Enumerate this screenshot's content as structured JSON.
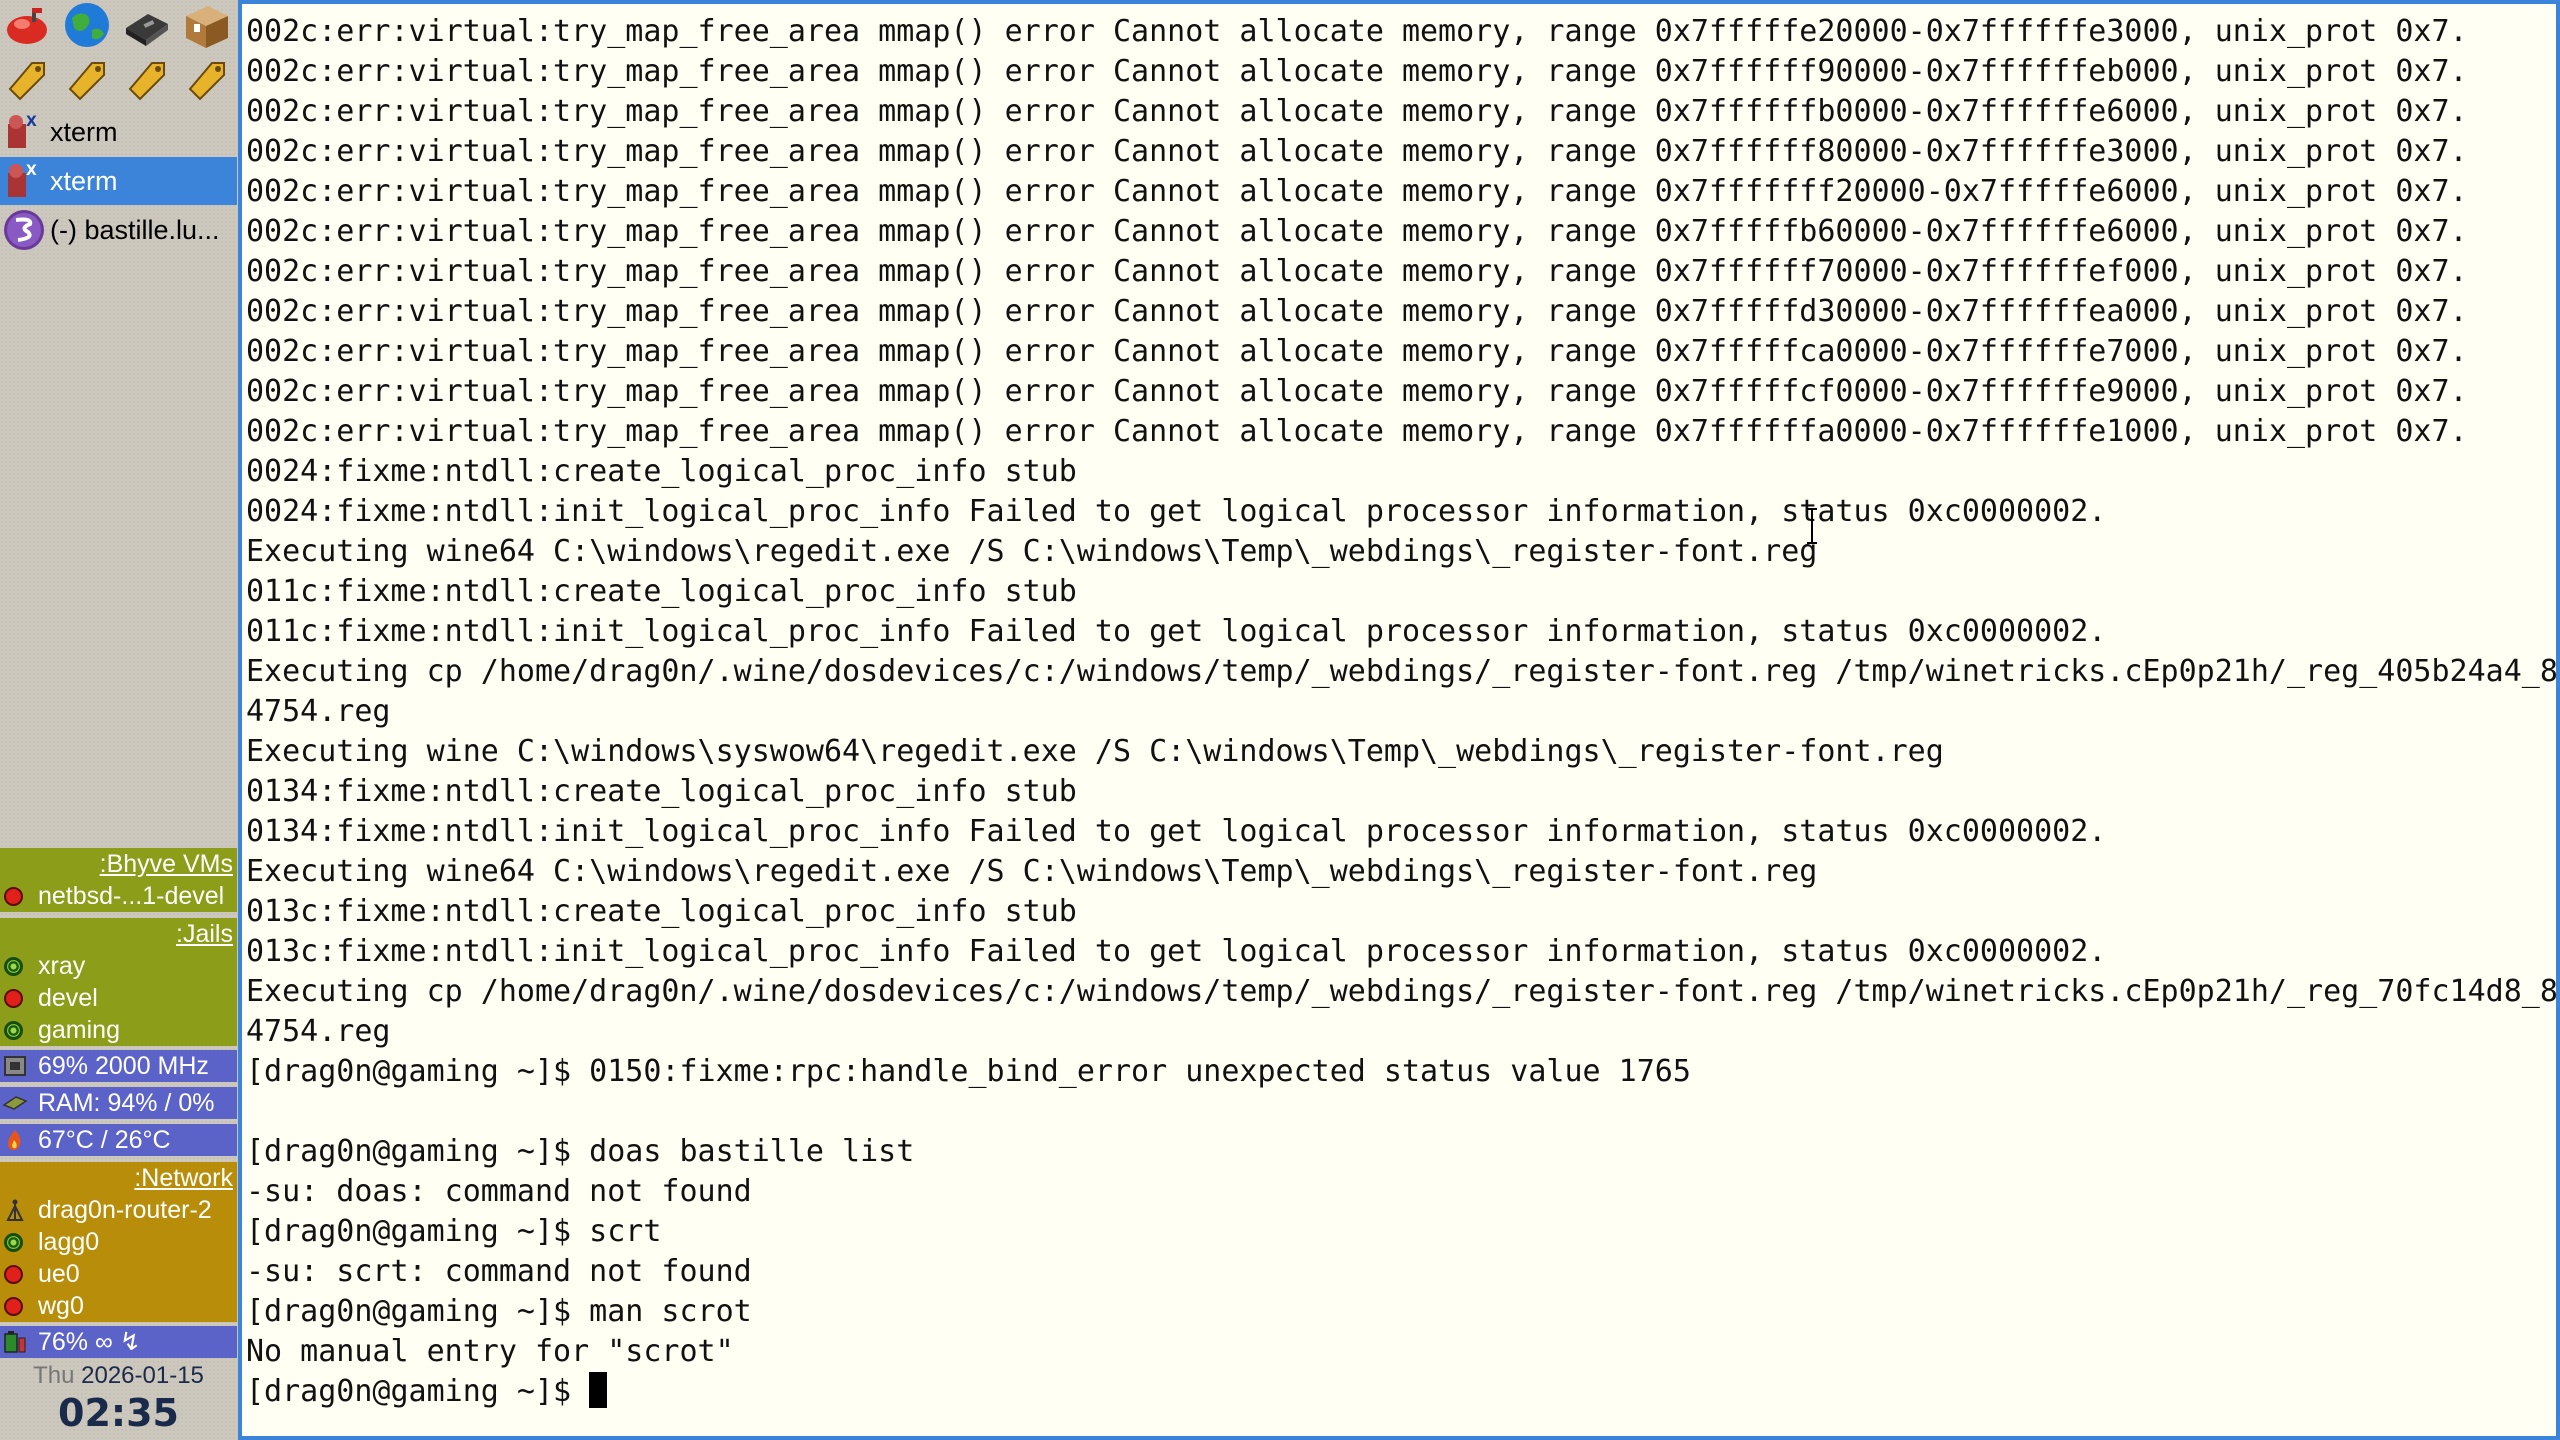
{
  "launchers": {
    "row1": [
      "mail-icon",
      "globe-icon",
      "disk-drive-icon",
      "package-icon"
    ],
    "row2": [
      "tag-icon",
      "tag-icon",
      "tag-icon",
      "tag-icon"
    ]
  },
  "tasks": [
    {
      "label": "xterm",
      "icon": "xterm-icon",
      "active": false
    },
    {
      "label": "xterm",
      "icon": "xterm-icon",
      "active": true
    },
    {
      "label": "(-) bastille.lu...",
      "icon": "emacs-icon",
      "active": false
    }
  ],
  "bhyve": {
    "header": ":Bhyve VMs",
    "items": [
      {
        "label": "netbsd-...1-devel",
        "status": "stopped"
      }
    ]
  },
  "jails": {
    "header": ":Jails",
    "items": [
      {
        "label": "xray",
        "status": "running"
      },
      {
        "label": "devel",
        "status": "stopped"
      },
      {
        "label": "gaming",
        "status": "running"
      }
    ]
  },
  "system": {
    "cpu": "69% 2000 MHz",
    "ram": "RAM: 94% / 0%",
    "temp": "67°C / 26°C"
  },
  "network": {
    "header": ":Network",
    "router": "drag0n-router-2",
    "items": [
      {
        "label": "lagg0",
        "status": "up"
      },
      {
        "label": "ue0",
        "status": "down"
      },
      {
        "label": "wg0",
        "status": "down"
      }
    ]
  },
  "battery": "76% ∞ ↯",
  "clock": {
    "day": "Thu",
    "date": "2026-01-15",
    "time": "02:35"
  },
  "terminal": {
    "lines": [
      "002c:err:virtual:try_map_free_area mmap() error Cannot allocate memory, range 0x7fffffe20000-0x7ffffffe3000, unix_prot 0x7.",
      "002c:err:virtual:try_map_free_area mmap() error Cannot allocate memory, range 0x7ffffff90000-0x7ffffffeb000, unix_prot 0x7.",
      "002c:err:virtual:try_map_free_area mmap() error Cannot allocate memory, range 0x7ffffffb0000-0x7ffffffe6000, unix_prot 0x7.",
      "002c:err:virtual:try_map_free_area mmap() error Cannot allocate memory, range 0x7ffffff80000-0x7ffffffe3000, unix_prot 0x7.",
      "002c:err:virtual:try_map_free_area mmap() error Cannot allocate memory, range 0x7fffffff20000-0x7fffffe6000, unix_prot 0x7.",
      "002c:err:virtual:try_map_free_area mmap() error Cannot allocate memory, range 0x7fffffb60000-0x7ffffffe6000, unix_prot 0x7.",
      "002c:err:virtual:try_map_free_area mmap() error Cannot allocate memory, range 0x7ffffff70000-0x7ffffffef000, unix_prot 0x7.",
      "002c:err:virtual:try_map_free_area mmap() error Cannot allocate memory, range 0x7fffffd30000-0x7ffffffea000, unix_prot 0x7.",
      "002c:err:virtual:try_map_free_area mmap() error Cannot allocate memory, range 0x7fffffca0000-0x7ffffffe7000, unix_prot 0x7.",
      "002c:err:virtual:try_map_free_area mmap() error Cannot allocate memory, range 0x7fffffcf0000-0x7ffffffe9000, unix_prot 0x7.",
      "002c:err:virtual:try_map_free_area mmap() error Cannot allocate memory, range 0x7ffffffa0000-0x7ffffffe1000, unix_prot 0x7.",
      "0024:fixme:ntdll:create_logical_proc_info stub",
      "0024:fixme:ntdll:init_logical_proc_info Failed to get logical processor information, status 0xc0000002.",
      "Executing wine64 C:\\windows\\regedit.exe /S C:\\windows\\Temp\\_webdings\\_register-font.reg",
      "011c:fixme:ntdll:create_logical_proc_info stub",
      "011c:fixme:ntdll:init_logical_proc_info Failed to get logical processor information, status 0xc0000002.",
      "Executing cp /home/drag0n/.wine/dosdevices/c:/windows/temp/_webdings/_register-font.reg /tmp/winetricks.cEp0p21h/_reg_405b24a4_8",
      "4754.reg",
      "Executing wine C:\\windows\\syswow64\\regedit.exe /S C:\\windows\\Temp\\_webdings\\_register-font.reg",
      "0134:fixme:ntdll:create_logical_proc_info stub",
      "0134:fixme:ntdll:init_logical_proc_info Failed to get logical processor information, status 0xc0000002.",
      "Executing wine64 C:\\windows\\regedit.exe /S C:\\windows\\Temp\\_webdings\\_register-font.reg",
      "013c:fixme:ntdll:create_logical_proc_info stub",
      "013c:fixme:ntdll:init_logical_proc_info Failed to get logical processor information, status 0xc0000002.",
      "Executing cp /home/drag0n/.wine/dosdevices/c:/windows/temp/_webdings/_register-font.reg /tmp/winetricks.cEp0p21h/_reg_70fc14d8_8",
      "4754.reg",
      "[drag0n@gaming ~]$ 0150:fixme:rpc:handle_bind_error unexpected status value 1765",
      "",
      "[drag0n@gaming ~]$ doas bastille list",
      "-su: doas: command not found",
      "[drag0n@gaming ~]$ scrt",
      "-su: scrt: command not found",
      "[drag0n@gaming ~]$ man scrot",
      "No manual entry for \"scrot\""
    ],
    "prompt": "[drag0n@gaming ~]$ "
  },
  "colors": {
    "accent": "#3b84d9",
    "terminal_bg": "#fffff4",
    "jails_panel": "#8c9d19",
    "system_panel": "#5b63c9",
    "network_panel": "#b88d0a"
  }
}
